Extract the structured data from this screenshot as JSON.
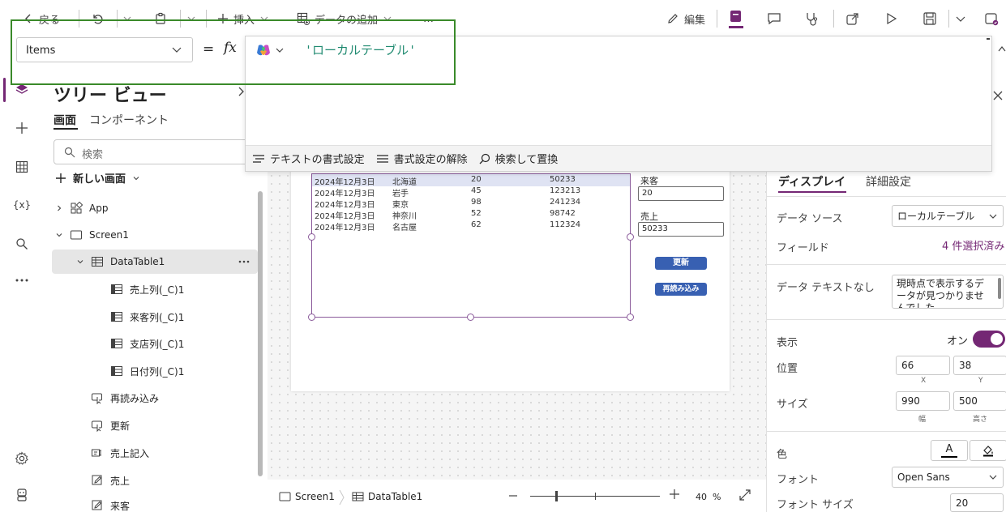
{
  "toolbar": {
    "back": "戻る",
    "insert": "挿入",
    "add_data": "データの追加",
    "more": "…",
    "edit": "編集"
  },
  "formula": {
    "property": "Items",
    "equals": "=",
    "fx": "fx",
    "value": "'ローカルテーブル'",
    "footer": {
      "format_text": "テキストの書式設定",
      "remove_format": "書式設定の解除",
      "find_replace": "検索して置換"
    }
  },
  "tree": {
    "title": "ツリー ビュー",
    "tabs": [
      "画面",
      "コンポーネント"
    ],
    "search_placeholder": "検索",
    "new_screen": "新しい画面",
    "items": [
      {
        "label": "App"
      },
      {
        "label": "Screen1"
      },
      {
        "label": "DataTable1"
      },
      {
        "label": "売上列(_C)1"
      },
      {
        "label": "来客列(_C)1"
      },
      {
        "label": "支店列(_C)1"
      },
      {
        "label": "日付列(_C)1"
      },
      {
        "label": "再読み込み"
      },
      {
        "label": "更新"
      },
      {
        "label": "売上記入"
      },
      {
        "label": "売上"
      },
      {
        "label": "来客"
      }
    ]
  },
  "table": {
    "rows": [
      [
        "2024年12月3日",
        "北海道",
        "20",
        "50233"
      ],
      [
        "2024年12月3日",
        "岩手",
        "45",
        "123213"
      ],
      [
        "2024年12月3日",
        "東京",
        "98",
        "241234"
      ],
      [
        "2024年12月3日",
        "神奈川",
        "52",
        "98742"
      ],
      [
        "2024年12月3日",
        "名古屋",
        "62",
        "112324"
      ]
    ]
  },
  "form": {
    "visitors_label": "来客",
    "visitors_value": "20",
    "sales_label": "売上",
    "sales_value": "50233",
    "update_button": "更新",
    "reload_button": "再読み込み"
  },
  "status": {
    "screen": "Screen1",
    "control": "DataTable1",
    "zoom": "40",
    "zoom_unit": "%"
  },
  "props": {
    "tabs": [
      "ディスプレイ",
      "詳細設定"
    ],
    "data_source_label": "データ ソース",
    "data_source_value": "ローカルテーブル",
    "fields_label": "フィールド",
    "fields_value": "4 件選択済み",
    "no_data_label": "データ テキストなし",
    "no_data_value": "現時点で表示するデータが見つかりませんでした",
    "visible_label": "表示",
    "visible_value": "オン",
    "position_label": "位置",
    "pos_x": "66",
    "pos_y": "38",
    "pos_x_cap": "X",
    "pos_y_cap": "Y",
    "size_label": "サイズ",
    "width": "990",
    "height": "500",
    "width_cap": "幅",
    "height_cap": "高さ",
    "color_label": "色",
    "font_label": "フォント",
    "font_value": "Open Sans",
    "font_size_label": "フォント サイズ",
    "font_size_value": "20",
    "color_text_glyph": "A"
  },
  "colors": {
    "accent": "#742774",
    "formula_text": "#1f8a70",
    "button_blue": "#3860b2",
    "selection_row": "#dfe3f3",
    "highlight_box": "#3a8a2a"
  }
}
